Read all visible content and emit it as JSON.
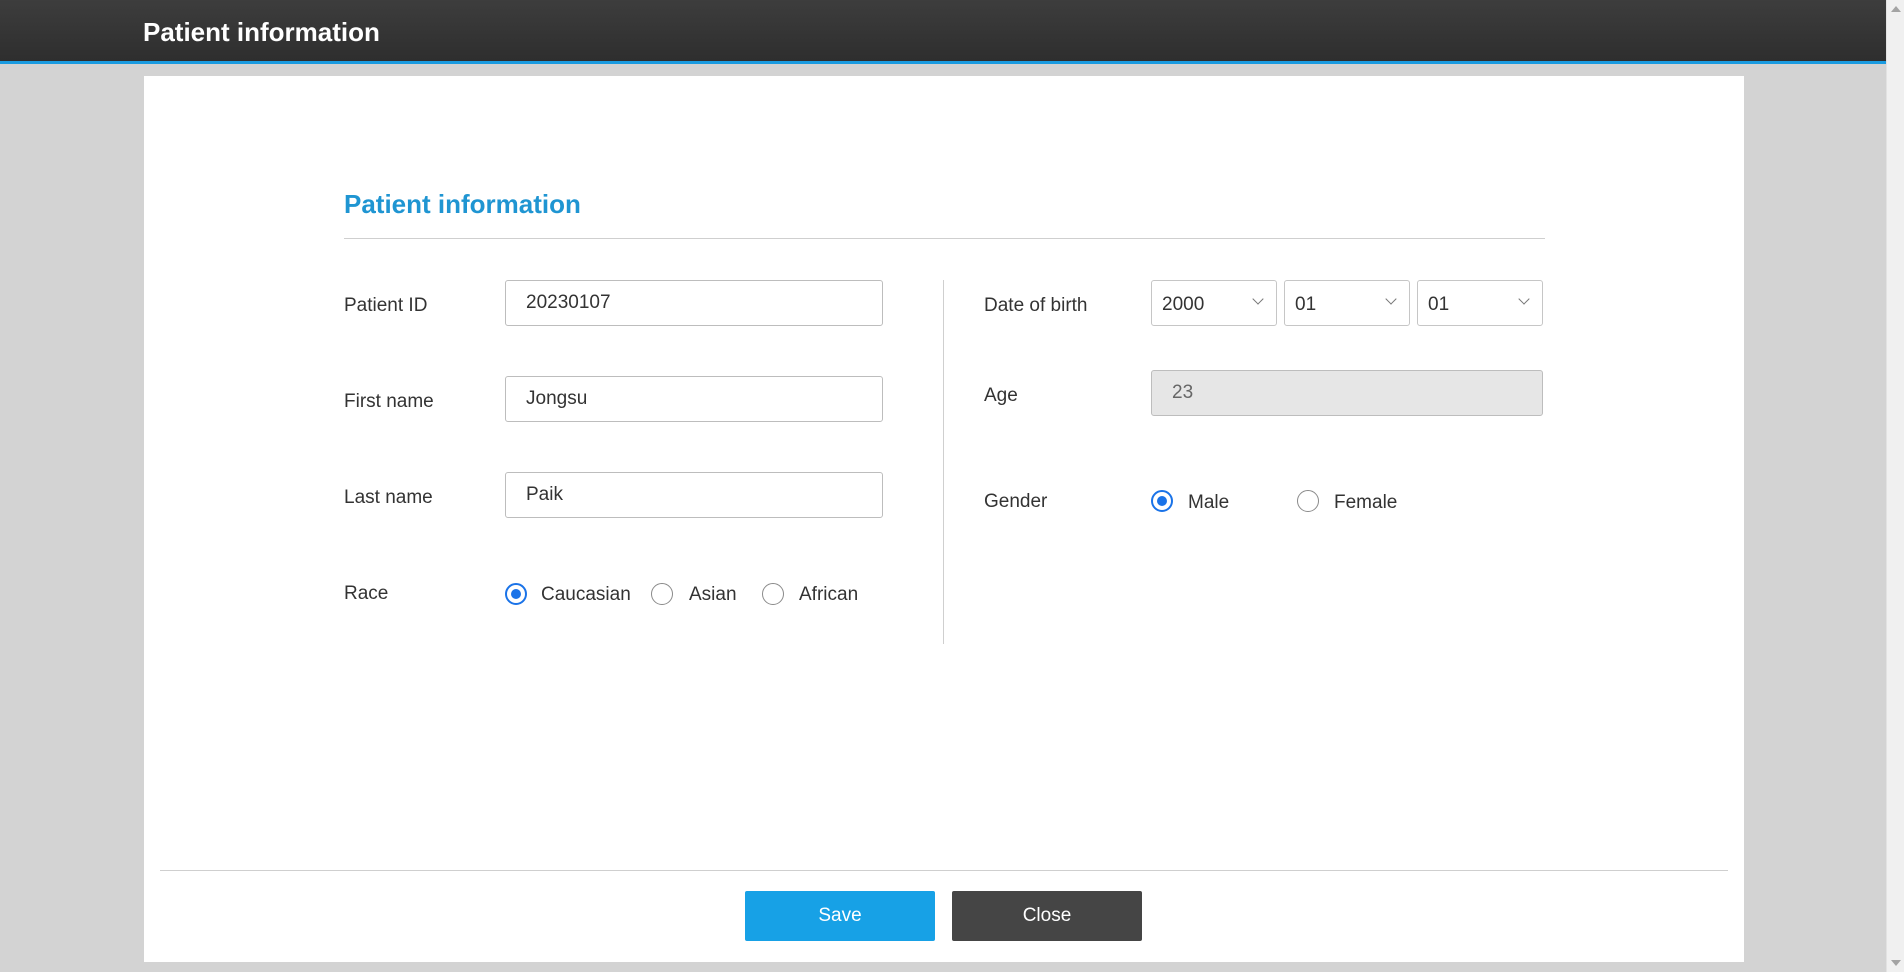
{
  "window": {
    "title": "Patient information"
  },
  "form": {
    "section_title": "Patient information",
    "patient_id": {
      "label": "Patient ID",
      "value": "20230107"
    },
    "first_name": {
      "label": "First name",
      "value": "Jongsu"
    },
    "last_name": {
      "label": "Last name",
      "value": "Paik"
    },
    "race": {
      "label": "Race",
      "options": [
        "Caucasian",
        "Asian",
        "African"
      ],
      "selected": "Caucasian"
    },
    "date_of_birth": {
      "label": "Date of birth",
      "year": "2000",
      "month": "01",
      "day": "01"
    },
    "age": {
      "label": "Age",
      "value": "23"
    },
    "gender": {
      "label": "Gender",
      "options": [
        "Male",
        "Female"
      ],
      "selected": "Male"
    }
  },
  "footer": {
    "save_label": "Save",
    "close_label": "Close"
  },
  "colors": {
    "accent": "#1f95d2",
    "save": "#17a1e6",
    "close": "#454545",
    "header": "#333333"
  }
}
